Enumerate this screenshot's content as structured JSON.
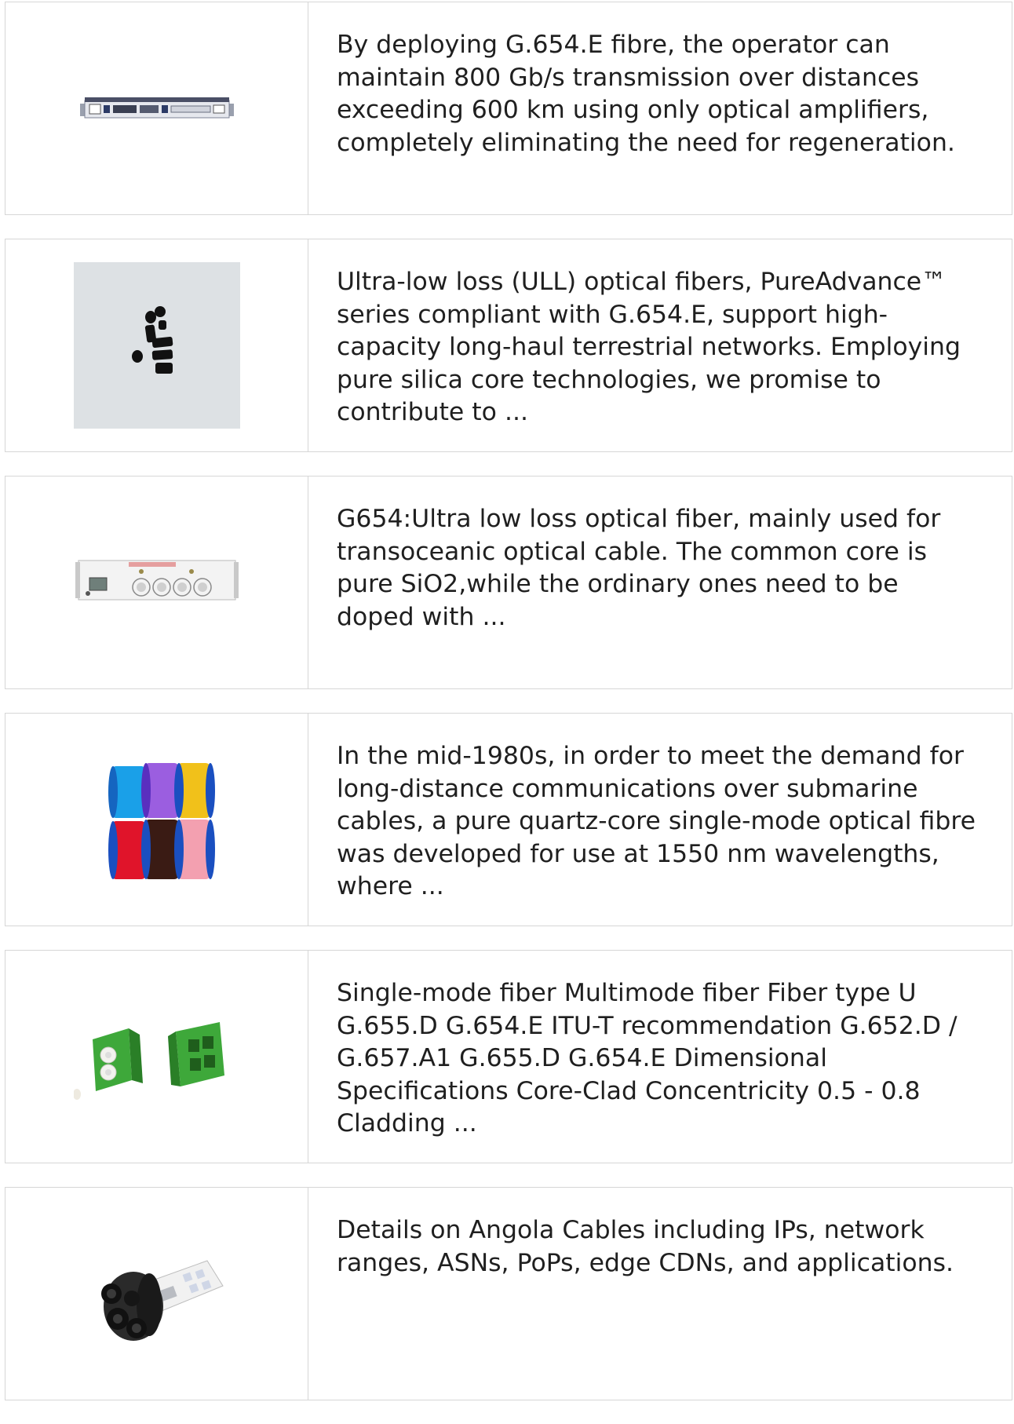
{
  "results": [
    {
      "image_icon": "rack-transmission-equipment-icon",
      "snippet": "By deploying G.654.E fibre, the operator can maintain 800 Gb/s transmission over distances exceeding 600 km using only optical amplifiers, completely eliminating the need for regeneration."
    },
    {
      "image_icon": "black-fiber-end-caps-icon",
      "snippet": "Ultra-low loss (ULL) optical fibers, PureAdvance™ series compliant with G.654.E, support high-capacity long-haul terrestrial networks. Employing pure silica core technologies, we promise to contribute to ..."
    },
    {
      "image_icon": "optical-amplifier-chassis-icon",
      "snippet": "G654:Ultra low loss optical fiber, mainly used for transoceanic optical cable. The common core is pure SiO2,while the ordinary ones need to be doped with ..."
    },
    {
      "image_icon": "colored-fiber-spools-icon",
      "snippet": "In the mid-1980s, in order to meet the demand for long-distance communications over submarine cables, a pure quartz-core single-mode optical fibre was developed for use at 1550 nm wavelengths, where ..."
    },
    {
      "image_icon": "green-lc-adapters-icon",
      "snippet": "Single-mode fiber Multimode fiber Fiber type U G.655.D G.654.E ITU-T recommendation G.652.D / G.657.A1 G.655.D G.654.E Dimensional Specifications Core-Clad Concentricity 0.5 - 0.8 Cladding ..."
    },
    {
      "image_icon": "fiber-splice-closure-icon",
      "snippet": "Details on Angola Cables including IPs, network ranges, ASNs, PoPs, edge CDNs, and applications."
    }
  ]
}
